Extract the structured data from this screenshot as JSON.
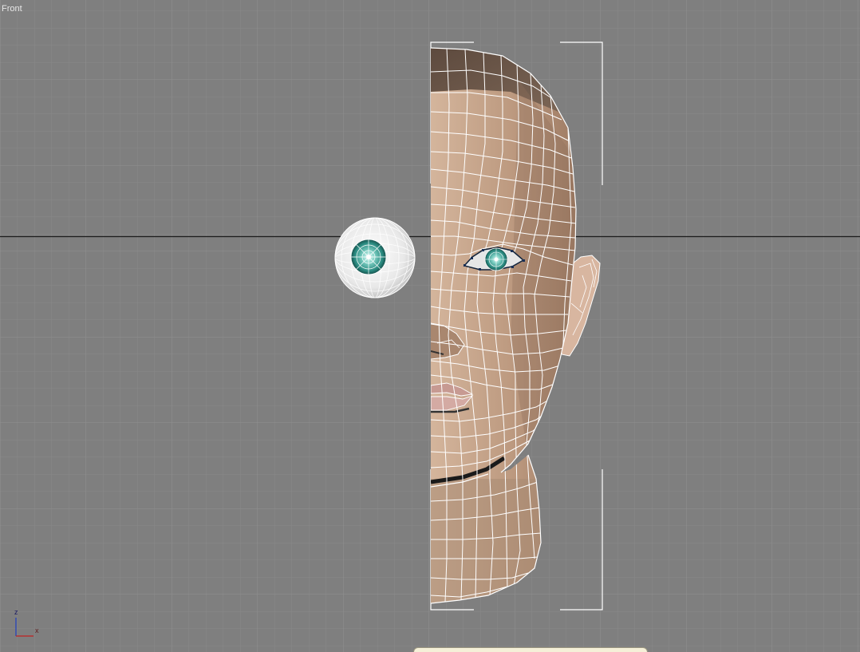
{
  "viewport": {
    "label": "Front",
    "background": "#7f7f7f",
    "accent_border": "#f2b51a"
  },
  "scene": {
    "objects": [
      "eyeball-sphere",
      "half-head-mesh",
      "ear"
    ],
    "skin_color": "#c9a890",
    "iris_color": "#2f9e8f",
    "wire_color": "#ffffff"
  },
  "axis_gizmo": {
    "z_label": "z",
    "x_label": "x"
  }
}
